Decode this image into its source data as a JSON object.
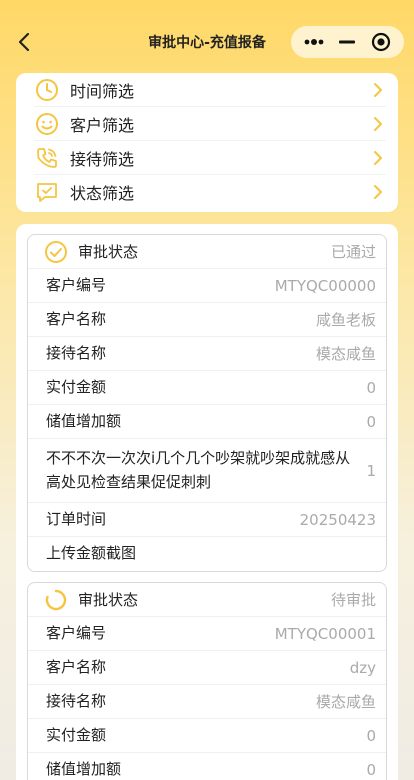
{
  "nav": {
    "title": "审批中心-充值报备"
  },
  "filters": [
    {
      "label": "时间筛选",
      "icon": "clock-icon"
    },
    {
      "label": "客户筛选",
      "icon": "smiley-icon"
    },
    {
      "label": "接待筛选",
      "icon": "phone-icon"
    },
    {
      "label": "状态筛选",
      "icon": "chat-check-icon"
    }
  ],
  "colors": {
    "accent": "#f5c542",
    "muted": "#aaaaaa"
  },
  "records": [
    {
      "status_label": "审批状态",
      "status_value": "已通过",
      "status_icon": "check-circle-icon",
      "rows": [
        {
          "k": "客户编号",
          "v": "MTYQC00000"
        },
        {
          "k": "客户名称",
          "v": "咸鱼老板"
        },
        {
          "k": "接待名称",
          "v": "模态咸鱼"
        },
        {
          "k": "实付金额",
          "v": "0"
        },
        {
          "k": "储值增加额",
          "v": "0"
        },
        {
          "k": "不不不次一次次i几个几个吵架就吵架成就感从高处见检查结果促促刺刺",
          "v": "1"
        },
        {
          "k": "订单时间",
          "v": "20250423"
        },
        {
          "k": "上传金额截图",
          "v": ""
        }
      ]
    },
    {
      "status_label": "审批状态",
      "status_value": "待审批",
      "status_icon": "loading-icon",
      "rows": [
        {
          "k": "客户编号",
          "v": "MTYQC00001"
        },
        {
          "k": "客户名称",
          "v": "dzy"
        },
        {
          "k": "接待名称",
          "v": "模态咸鱼"
        },
        {
          "k": "实付金额",
          "v": "0"
        },
        {
          "k": "储值增加额",
          "v": "0"
        }
      ]
    }
  ]
}
